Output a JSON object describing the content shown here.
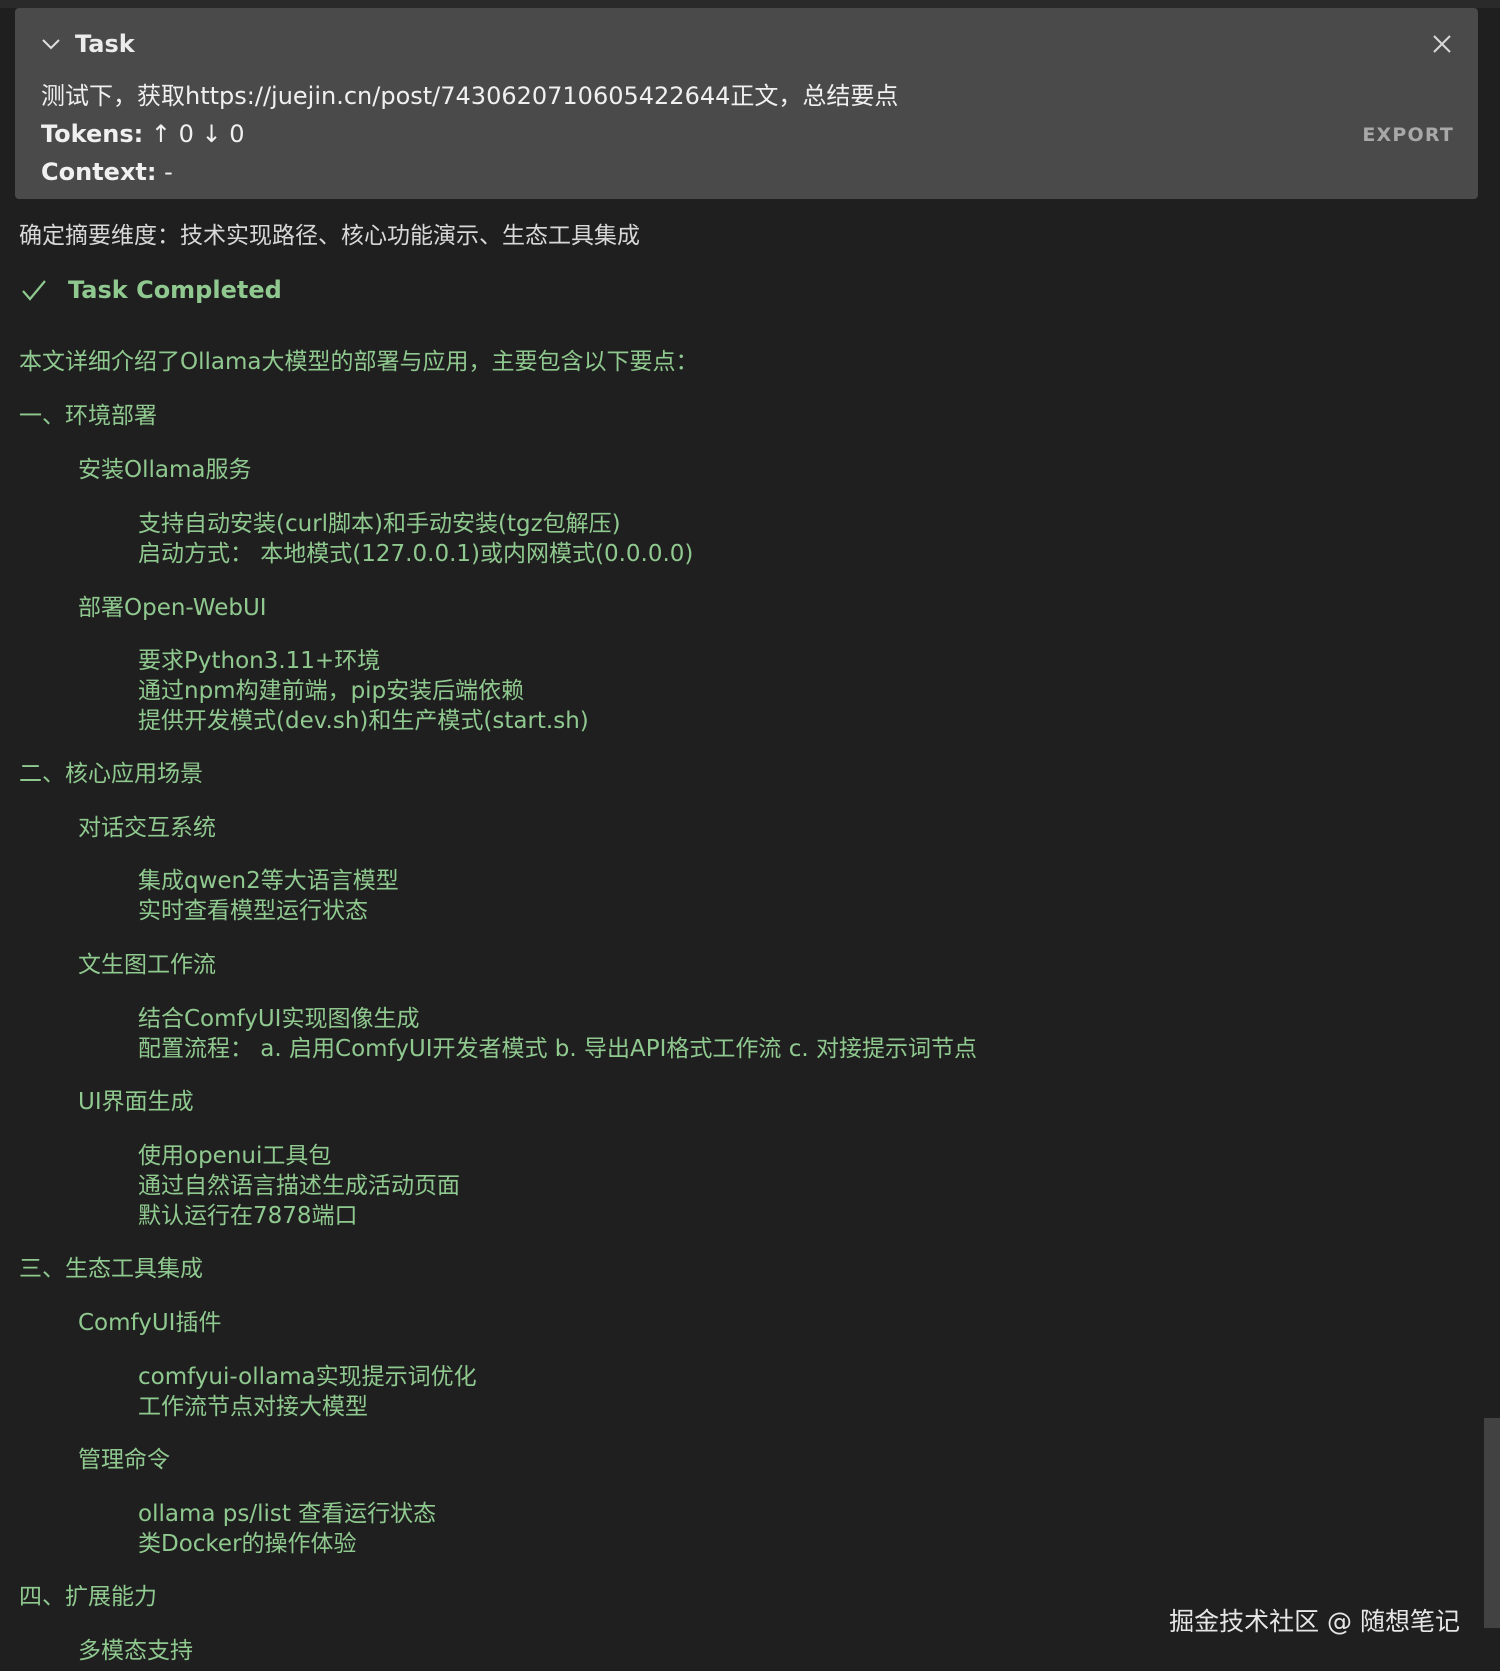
{
  "task": {
    "title": "Task",
    "text": "测试下，获取https://juejin.cn/post/7430620710605422644正文，总结要点",
    "tokens_label": "Tokens:",
    "tokens_up": "↑ 0",
    "tokens_down": "↓ 0",
    "context_label": "Context:",
    "context_value": "-",
    "export_label": "EXPORT"
  },
  "status_line": "确定摘要维度：技术实现路径、核心功能演示、生态工具集成",
  "completed_label": "Task Completed",
  "summary": {
    "intro": "本文详细介绍了Ollama大模型的部署与应用，主要包含以下要点：",
    "s1_title": "一、环境部署",
    "s1_a_title": "安装Ollama服务",
    "s1_a_1": "支持自动安装(curl脚本)和手动安装(tgz包解压)",
    "s1_a_2": "启动方式： 本地模式(127.0.0.1)或内网模式(0.0.0.0)",
    "s1_b_title": "部署Open-WebUI",
    "s1_b_1": "要求Python3.11+环境",
    "s1_b_2": "通过npm构建前端，pip安装后端依赖",
    "s1_b_3": "提供开发模式(dev.sh)和生产模式(start.sh)",
    "s2_title": "二、核心应用场景",
    "s2_a_title": "对话交互系统",
    "s2_a_1": "集成qwen2等大语言模型",
    "s2_a_2": "实时查看模型运行状态",
    "s2_b_title": "文生图工作流",
    "s2_b_1": "结合ComfyUI实现图像生成",
    "s2_b_2": "配置流程： a. 启用ComfyUI开发者模式 b. 导出API格式工作流 c. 对接提示词节点",
    "s2_c_title": "UI界面生成",
    "s2_c_1": "使用openui工具包",
    "s2_c_2": "通过自然语言描述生成活动页面",
    "s2_c_3": "默认运行在7878端口",
    "s3_title": "三、生态工具集成",
    "s3_a_title": "ComfyUI插件",
    "s3_a_1": "comfyui-ollama实现提示词优化",
    "s3_a_2": "工作流节点对接大模型",
    "s3_b_title": "管理命令",
    "s3_b_1": "ollama ps/list 查看运行状态",
    "s3_b_2": "类Docker的操作体验",
    "s4_title": "四、扩展能力",
    "s4_a_title": "多模态支持"
  },
  "watermark": "掘金技术社区 @ 随想笔记",
  "icons": {
    "collapse": "chevron-down-icon",
    "close": "close-icon",
    "completed": "checkmark-icon"
  },
  "colors": {
    "background": "#1f1f1f",
    "header_bg": "#4a4a4a",
    "completion_green": "#8fc98f",
    "export_gray": "#a8a8a8"
  }
}
